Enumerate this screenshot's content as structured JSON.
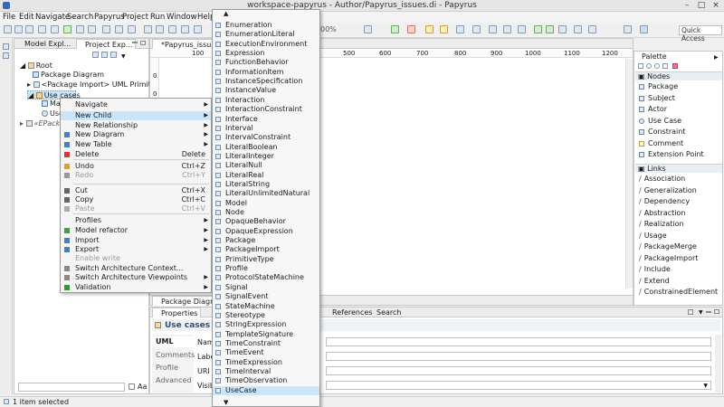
{
  "window": {
    "title": "workspace-papyrus - Author/Papyrus_issues.di - Papyrus",
    "min": "–",
    "max": "□",
    "close": "×"
  },
  "menubar": [
    "File",
    "Edit",
    "Navigate",
    "Search",
    "Papyrus",
    "Project",
    "Run",
    "Window",
    "Help"
  ],
  "toolbar": {
    "zoom": "00%",
    "quick_access": "Quick Access"
  },
  "left_panel": {
    "tabs": [
      "Model Expl...",
      "Project Exp..."
    ],
    "tree": [
      {
        "label": "Root"
      },
      {
        "label": "Package Diagram"
      },
      {
        "label": "<Package Import> UML Primitive"
      },
      {
        "label": "Use cases"
      },
      {
        "label": "Mai"
      },
      {
        "label": "Use"
      },
      {
        "label": "«EPacka"
      }
    ],
    "filter_label": "Aa"
  },
  "editor": {
    "tab": "*Papyrus_issues.d",
    "ruler": [
      "100",
      "500",
      "600",
      "700",
      "800",
      "900",
      "1000",
      "1100",
      "1200"
    ],
    "side_marks": [
      "0",
      "0"
    ],
    "bottom_tab": "Package Diagram"
  },
  "context_menu": {
    "items": [
      {
        "label": "Navigate",
        "accel": "",
        "submenu": true,
        "disabled": false,
        "highlight": false
      },
      {
        "label": "New Child",
        "accel": "",
        "submenu": true,
        "disabled": false,
        "highlight": true
      },
      {
        "label": "New Relationship",
        "accel": "",
        "submenu": true,
        "disabled": false,
        "highlight": false
      },
      {
        "label": "New Diagram",
        "accel": "",
        "submenu": true,
        "disabled": false,
        "highlight": false
      },
      {
        "label": "New Table",
        "accel": "",
        "submenu": true,
        "disabled": false,
        "highlight": false
      },
      {
        "label": "Delete",
        "accel": "Delete",
        "submenu": false,
        "disabled": false,
        "highlight": false
      },
      {
        "label": "Undo",
        "accel": "Ctrl+Z",
        "submenu": false,
        "disabled": false,
        "highlight": false
      },
      {
        "label": "Redo",
        "accel": "Ctrl+Y",
        "submenu": false,
        "disabled": true,
        "highlight": false
      },
      {
        "label": "Cut",
        "accel": "Ctrl+X",
        "submenu": false,
        "disabled": false,
        "highlight": false
      },
      {
        "label": "Copy",
        "accel": "Ctrl+C",
        "submenu": false,
        "disabled": false,
        "highlight": false
      },
      {
        "label": "Paste",
        "accel": "Ctrl+V",
        "submenu": false,
        "disabled": true,
        "highlight": false
      },
      {
        "label": "Profiles",
        "accel": "",
        "submenu": true,
        "disabled": false,
        "highlight": false
      },
      {
        "label": "Model refactor",
        "accel": "",
        "submenu": true,
        "disabled": false,
        "highlight": false
      },
      {
        "label": "Import",
        "accel": "",
        "submenu": true,
        "disabled": false,
        "highlight": false
      },
      {
        "label": "Export",
        "accel": "",
        "submenu": true,
        "disabled": false,
        "highlight": false
      },
      {
        "label": "Enable write",
        "accel": "",
        "submenu": false,
        "disabled": true,
        "highlight": false
      },
      {
        "label": "Switch Architecture Context...",
        "accel": "",
        "submenu": false,
        "disabled": false,
        "highlight": false
      },
      {
        "label": "Switch Architecture Viewpoints",
        "accel": "",
        "submenu": true,
        "disabled": false,
        "highlight": false
      },
      {
        "label": "Validation",
        "accel": "",
        "submenu": true,
        "disabled": false,
        "highlight": false
      }
    ]
  },
  "submenu": {
    "items": [
      "Enumeration",
      "EnumerationLiteral",
      "ExecutionEnvironment",
      "Expression",
      "FunctionBehavior",
      "InformationItem",
      "InstanceSpecification",
      "InstanceValue",
      "Interaction",
      "InteractionConstraint",
      "Interface",
      "Interval",
      "IntervalConstraint",
      "LiteralBoolean",
      "LiteralInteger",
      "LiteralNull",
      "LiteralReal",
      "LiteralString",
      "LiteralUnlimitedNatural",
      "Model",
      "Node",
      "OpaqueBehavior",
      "OpaqueExpression",
      "Package",
      "PackageImport",
      "PrimitiveType",
      "Profile",
      "ProtocolStateMachine",
      "Signal",
      "SignalEvent",
      "StateMachine",
      "Stereotype",
      "StringExpression",
      "TemplateSignature",
      "TimeConstraint",
      "TimeEvent",
      "TimeExpression",
      "TimeInterval",
      "TimeObservation",
      "UseCase"
    ],
    "highlight": "UseCase"
  },
  "palette": {
    "title": "Palette",
    "nodes_header": "Nodes",
    "nodes": [
      "Package",
      "Subject",
      "Actor",
      "Use Case",
      "Constraint",
      "Comment",
      "Extension Point"
    ],
    "links_header": "Links",
    "links": [
      "Association",
      "Generalization",
      "Dependency",
      "Abstraction",
      "Realization",
      "Usage",
      "PackageMerge",
      "PackageImport",
      "Include",
      "Extend",
      "ConstrainedElement"
    ]
  },
  "properties": {
    "tab": "Properties",
    "other_tabs": [
      "References",
      "Search"
    ],
    "section_title": "Use cases",
    "side_tabs": [
      "UML",
      "Comments",
      "Profile",
      "Advanced"
    ],
    "field_labels": [
      "Name",
      "Label",
      "URI",
      "Visibi"
    ]
  },
  "status_bar": {
    "text": "1 item selected"
  }
}
